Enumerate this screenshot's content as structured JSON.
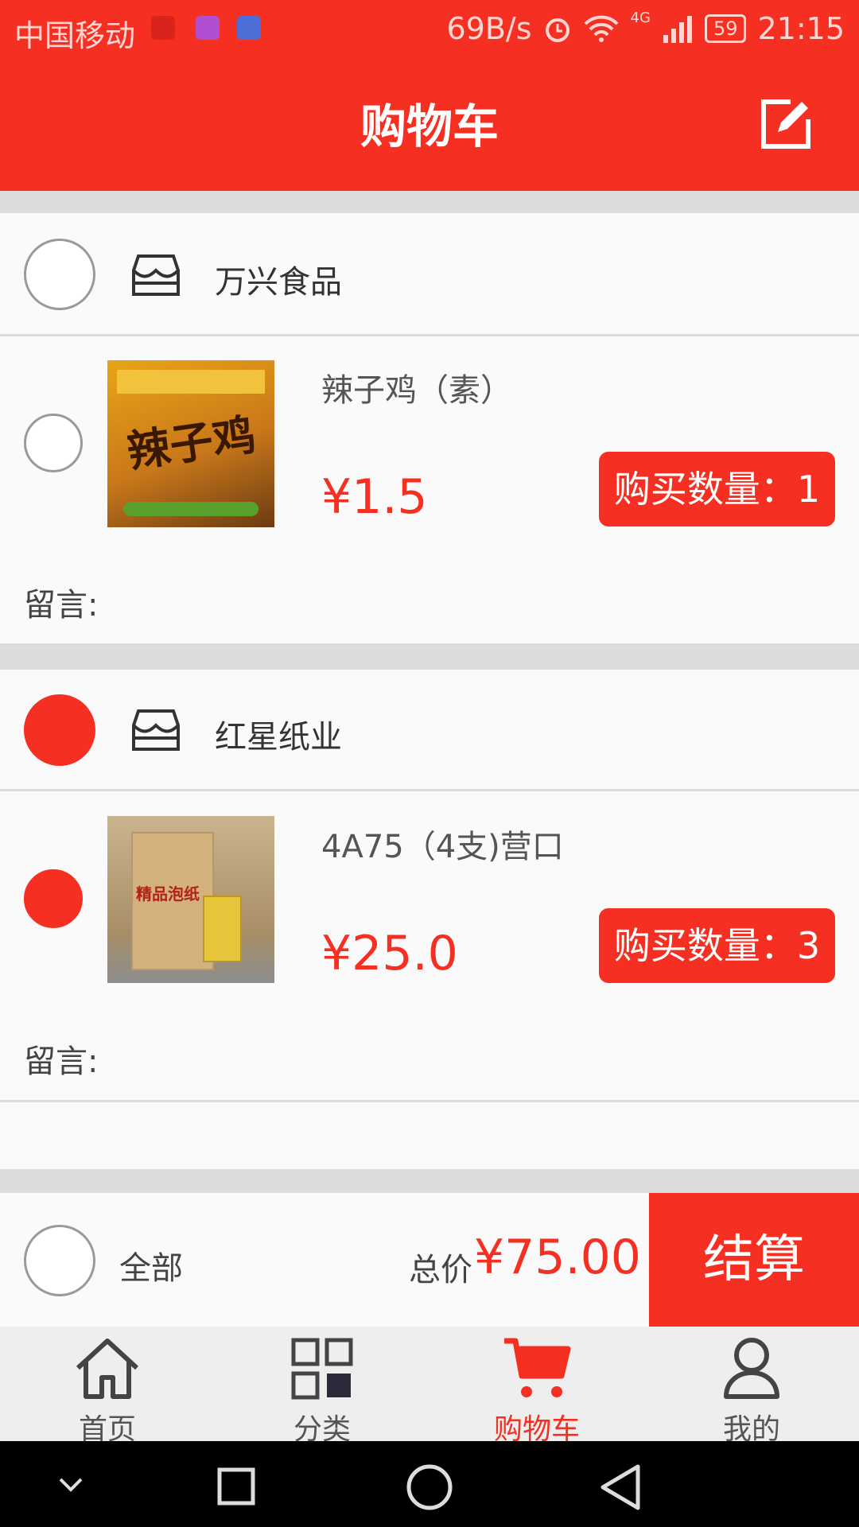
{
  "status_bar": {
    "carrier": "中国移动",
    "net_speed": "69B/s",
    "network": "4G",
    "battery": "59",
    "time": "21:15"
  },
  "header": {
    "title": "购物车",
    "edit_icon": "edit-icon"
  },
  "cart": [
    {
      "shop_name": "万兴食品",
      "shop_selected": false,
      "item": {
        "name": "辣子鸡（素）",
        "price": "¥1.5",
        "quantity_label": "购买数量：1",
        "selected": false,
        "message_label": "留言:",
        "image_caption": "辣子鸡"
      }
    },
    {
      "shop_name": "红星纸业",
      "shop_selected": true,
      "item": {
        "name": "4A75（4支)营口",
        "price": "¥25.0",
        "quantity_label": "购买数量：3",
        "selected": true,
        "message_label": "留言:",
        "image_caption": "精品泡纸"
      }
    }
  ],
  "summary": {
    "select_all_label": "全部",
    "total_label": "总价",
    "total_value": "¥75.00",
    "checkout_label": "结算"
  },
  "tabs": [
    {
      "label": "首页",
      "icon": "home-icon",
      "active": false
    },
    {
      "label": "分类",
      "icon": "category-icon",
      "active": false
    },
    {
      "label": "购物车",
      "icon": "cart-icon",
      "active": true
    },
    {
      "label": "我的",
      "icon": "profile-icon",
      "active": false
    }
  ],
  "colors": {
    "accent": "#f53022",
    "background": "#fafafa",
    "divider": "#dcdcdc"
  }
}
